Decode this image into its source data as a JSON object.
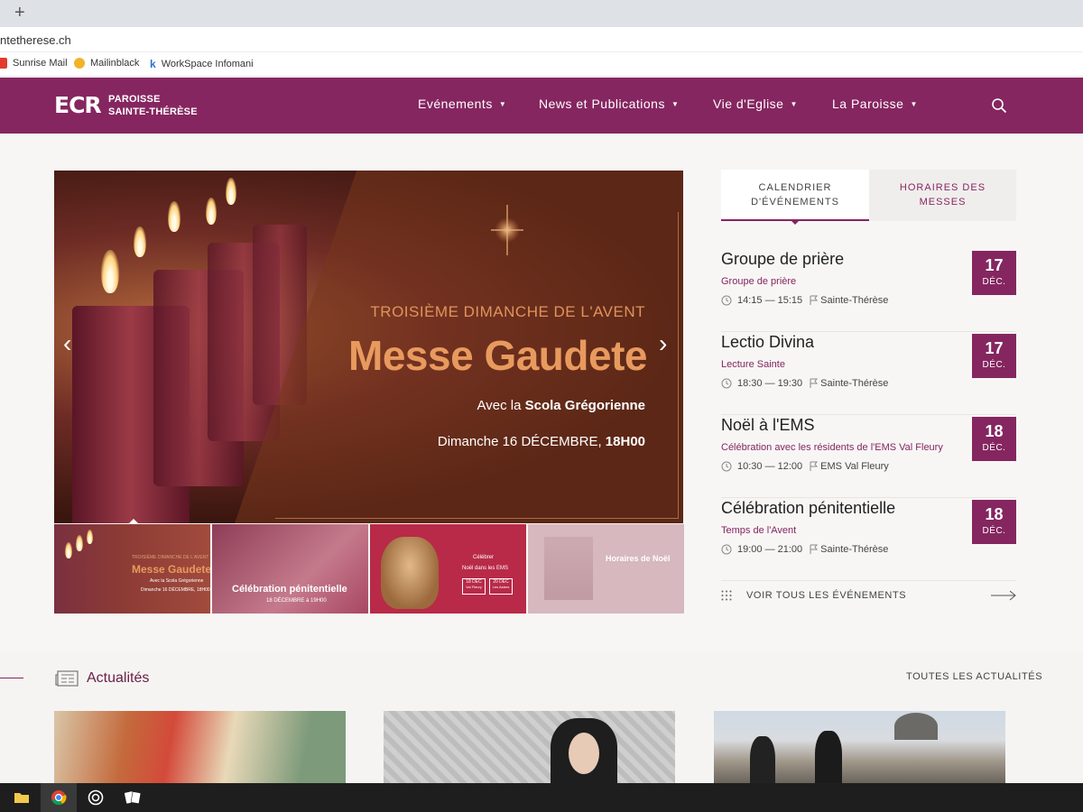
{
  "browser": {
    "new_tab_label": "+",
    "url": "ntetherese.ch",
    "bookmarks": [
      {
        "label": "Sunrise Mail",
        "icon": "sunrise-icon"
      },
      {
        "label": "Mailinblack",
        "icon": "mailinblack-icon"
      },
      {
        "label": "WorkSpace Infomani",
        "icon": "workspace-icon"
      }
    ]
  },
  "site": {
    "brand_color": "#852660",
    "logo_mark": "ECR",
    "logo_line1": "PAROISSE",
    "logo_line2": "SAINTE-THÉRÈSE",
    "nav": [
      {
        "label": "Evénements"
      },
      {
        "label": "News et Publications"
      },
      {
        "label": "Vie d'Eglise"
      },
      {
        "label": "La Paroisse"
      }
    ]
  },
  "slider": {
    "kicker": "TROISIÈME DIMANCHE DE L'AVENT",
    "title": "Messe Gaudete",
    "sub_prefix": "Avec la ",
    "sub_bold": "Scola Grégorienne",
    "date_prefix": "Dimanche 16 DÉCEMBRE, ",
    "date_bold": "18H00",
    "prev_label": "‹",
    "next_label": "›",
    "thumbs": [
      {
        "title": "Messe Gaudete",
        "kicker": "TROISIÈME DIMANCHE DE L'AVENT",
        "sub": "Avec la Scola Grégorienne",
        "date": "Dimanche 16 DÉCEMBRE, 18H00"
      },
      {
        "title": "Célébration pénitentielle",
        "date": "18 DÉCEMBRE à 19H00"
      },
      {
        "title": "Célébrer",
        "sub": "Noël dans les EMS",
        "badge1": "18 DÉC",
        "badge1_sub": "Val Fleury",
        "badge2": "20 DÉC",
        "badge2_sub": "Les Asters"
      },
      {
        "title": "Horaires de Noël"
      }
    ]
  },
  "sidebar": {
    "tab_calendar_line1": "CALENDRIER",
    "tab_calendar_line2": "D'ÉVÉNEMENTS",
    "tab_masses_line1": "HORAIRES DES",
    "tab_masses_line2": "MESSES",
    "events": [
      {
        "title": "Groupe de prière",
        "subtitle": "Groupe de prière",
        "time": "14:15 — 15:15",
        "place": "Sainte-Thérèse",
        "day": "17",
        "month": "DÉC."
      },
      {
        "title": "Lectio Divina",
        "subtitle": "Lecture Sainte",
        "time": "18:30 — 19:30",
        "place": "Sainte-Thérèse",
        "day": "17",
        "month": "DÉC."
      },
      {
        "title": "Noël à l'EMS",
        "subtitle": "Célébration avec les résidents de l'EMS Val Fleury",
        "time": "10:30 — 12:00",
        "place": "EMS Val Fleury",
        "day": "18",
        "month": "DÉC."
      },
      {
        "title": "Célébration pénitentielle",
        "subtitle": "Temps de l'Avent",
        "time": "19:00 — 21:00",
        "place": "Sainte-Thérèse",
        "day": "18",
        "month": "DÉC."
      }
    ],
    "all_events_label": "VOIR TOUS LES ÉVÉNEMENTS"
  },
  "news": {
    "title": "Actualités",
    "all_label": "TOUTES LES ACTUALITÉS"
  }
}
